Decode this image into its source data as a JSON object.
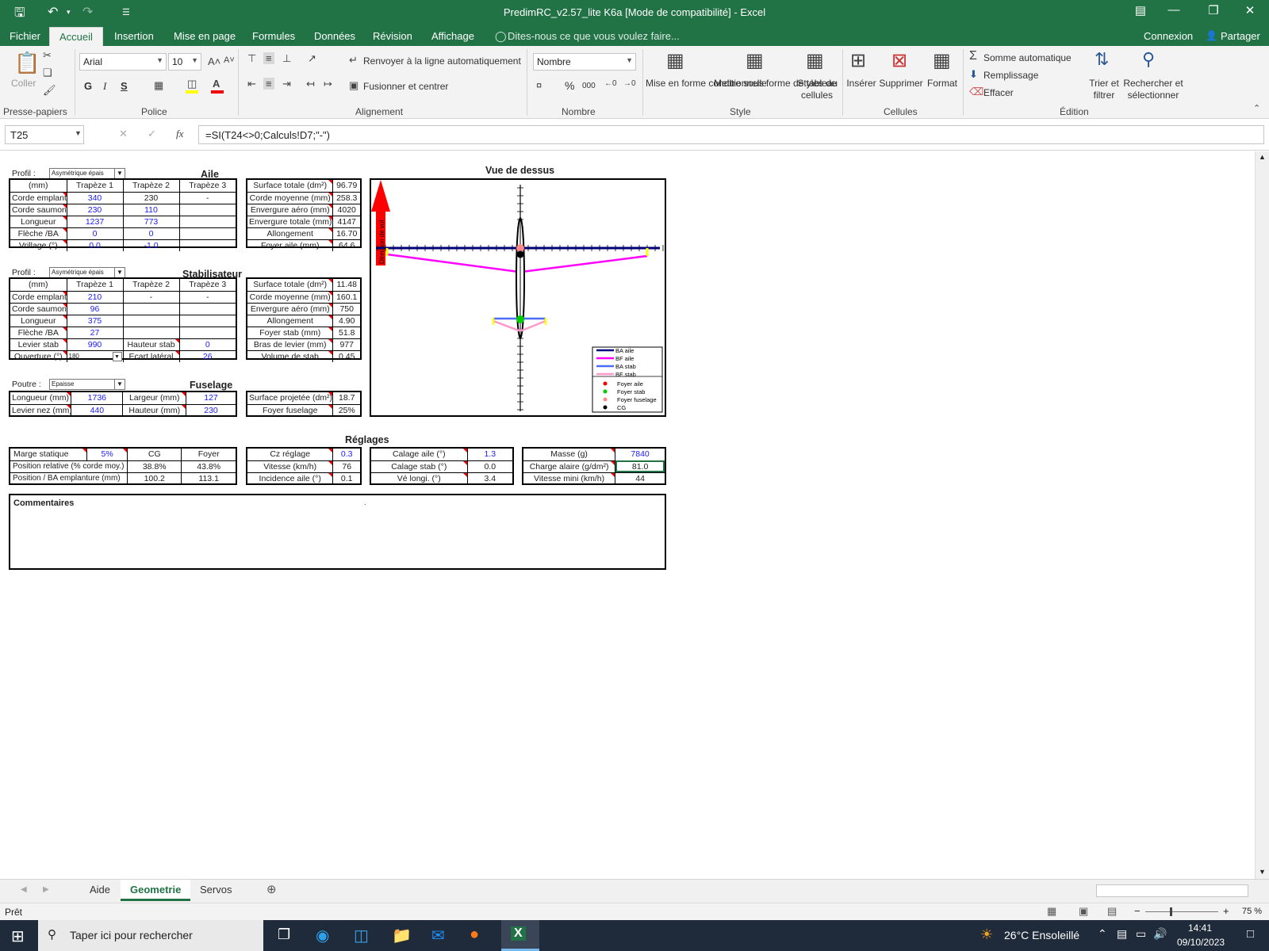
{
  "window": {
    "title": "PredimRC_v2.57_lite K6a  [Mode de compatibilité] - Excel"
  },
  "menu": {
    "tabs": [
      "Fichier",
      "Accueil",
      "Insertion",
      "Mise en page",
      "Formules",
      "Données",
      "Révision",
      "Affichage"
    ],
    "tell_me": "Dites-nous ce que vous voulez faire...",
    "signin": "Connexion",
    "share": "Partager"
  },
  "ribbon": {
    "clipboard": {
      "paste": "Coller",
      "group": "Presse-papiers"
    },
    "font": {
      "name": "Arial",
      "size": "10",
      "bold": "G",
      "italic": "I",
      "underline": "S",
      "group": "Police"
    },
    "alignment": {
      "wrap": "Renvoyer à la ligne automatiquement",
      "merge": "Fusionner et centrer",
      "group": "Alignement"
    },
    "number": {
      "format": "Nombre",
      "percent": "%",
      "thousands": "000",
      "group": "Nombre"
    },
    "style": {
      "conditional": "Mise en forme conditionnelle",
      "table": "Mettre sous forme de tableau",
      "cell_styles": "Styles de cellules",
      "group": "Style"
    },
    "cells": {
      "insert": "Insérer",
      "delete": "Supprimer",
      "format": "Format",
      "group": "Cellules"
    },
    "editing": {
      "autosum": "Somme automatique",
      "fill": "Remplissage",
      "clear": "Effacer",
      "sort": "Trier et filtrer",
      "find": "Rechercher et sélectionner",
      "group": "Édition"
    }
  },
  "formula": {
    "cell_ref": "T25",
    "fx": "fx",
    "content": "=SI(T24<>0;Calculs!D7;\"-\")"
  },
  "sheet": {
    "wing": {
      "title": "Aile",
      "profile_label": "Profil :",
      "profile_value": "Asymétrique épais",
      "header": [
        "(mm)",
        "Trapèze 1",
        "Trapèze 2",
        "Trapèze 3"
      ],
      "rows": [
        [
          "Corde emplant.",
          "340",
          "230",
          "-"
        ],
        [
          "Corde saumon",
          "230",
          "110",
          ""
        ],
        [
          "Longueur",
          "1237",
          "773",
          ""
        ],
        [
          "Flèche /BA",
          "0",
          "0",
          ""
        ],
        [
          "Vrillage (°)",
          "0.0",
          "-1.0",
          ""
        ]
      ],
      "results": [
        [
          "Surface totale (dm²)",
          "96.79"
        ],
        [
          "Corde moyenne (mm)",
          "258.3"
        ],
        [
          "Envergure aéro (mm)",
          "4020"
        ],
        [
          "Envergure totale (mm)",
          "4147"
        ],
        [
          "Allongement",
          "16.70"
        ],
        [
          "Foyer aile (mm)",
          "64.6"
        ]
      ]
    },
    "stab": {
      "title": "Stabilisateur",
      "profile_label": "Profil :",
      "profile_value": "Asymétrique épais",
      "header": [
        "(mm)",
        "Trapèze 1",
        "Trapèze 2",
        "Trapèze 3"
      ],
      "rows": [
        [
          "Corde emplant.",
          "210",
          "-",
          "-"
        ],
        [
          "Corde saumon",
          "96",
          "",
          ""
        ],
        [
          "Longueur",
          "375",
          "",
          ""
        ],
        [
          "Flèche /BA",
          "27",
          "",
          ""
        ]
      ],
      "lever": [
        "Levier stab",
        "990",
        "Hauteur stab",
        "0"
      ],
      "opening": [
        "Ouverture (°)",
        "180",
        "Ecart latéral",
        "26"
      ],
      "results": [
        [
          "Surface totale (dm²)",
          "11.48"
        ],
        [
          "Corde moyenne (mm)",
          "160.1"
        ],
        [
          "Envergure aéro (mm)",
          "750"
        ],
        [
          "Allongement",
          "4.90"
        ],
        [
          "Foyer stab (mm)",
          "51.8"
        ],
        [
          "Bras de levier (mm)",
          "977"
        ],
        [
          "Volume de stab",
          "0.45"
        ]
      ]
    },
    "fuselage": {
      "title": "Fuselage",
      "beam_label": "Poutre :",
      "beam_value": "Epaisse",
      "rows": [
        [
          "Longueur (mm)",
          "1736",
          "Largeur (mm)",
          "127"
        ],
        [
          "Levier nez (mm)",
          "440",
          "Hauteur (mm)",
          "230"
        ]
      ],
      "results": [
        [
          "Surface projetée (dm²)",
          "18.7"
        ],
        [
          "Foyer fuselage",
          "25%"
        ]
      ]
    },
    "top_view": {
      "title": "Vue de dessus",
      "direction": "Direction de vol",
      "legend": [
        "BA aile",
        "BF aile",
        "BA stab",
        "BF stab",
        "Foyer aile",
        "Foyer stab",
        "Foyer fuselage",
        "CG"
      ],
      "colors": {
        "ba_aile": "#000080",
        "bf_aile": "#ff00ff",
        "ba_stab": "#4a6cf7",
        "bf_stab": "#ff99cc",
        "foyer_aile": "#ff0000",
        "foyer_stab": "#00cc00",
        "foyer_fuselage": "#ff8888",
        "cg": "#000000"
      }
    },
    "settings": {
      "title": "Réglages",
      "margin": {
        "label": "Marge statique",
        "value": "5%",
        "cg_header": "CG",
        "foyer_header": "Foyer",
        "rows": [
          [
            "Position relative (% corde moy.)",
            "38.8%",
            "43.8%"
          ],
          [
            "Position / BA emplanture (mm)",
            "100.2",
            "113.1"
          ]
        ]
      },
      "cz": [
        [
          "Cz réglage",
          "0.3"
        ],
        [
          "Vitesse  (km/h)",
          "76"
        ],
        [
          "Incidence aile (°)",
          "0.1"
        ]
      ],
      "calage": [
        [
          "Calage aile (°)",
          "1.3"
        ],
        [
          "Calage stab (°)",
          "0.0"
        ],
        [
          "Vé longi. (°)",
          "3.4"
        ]
      ],
      "mass": [
        [
          "Masse (g)",
          "7840"
        ],
        [
          "Charge alaire (g/dm²)",
          "81.0"
        ],
        [
          "Vitesse mini (km/h)",
          "44"
        ]
      ]
    },
    "comments": {
      "title": "Commentaires",
      "dot": "."
    }
  },
  "tabs": {
    "items": [
      "Aide",
      "Geometrie",
      "Servos"
    ],
    "active": "Geometrie"
  },
  "status": {
    "text": "Prêt",
    "zoom": "75 %"
  },
  "taskbar": {
    "search": "Taper ici pour rechercher",
    "weather": "26°C  Ensoleillé",
    "time": "14:41",
    "date": "09/10/2023"
  }
}
